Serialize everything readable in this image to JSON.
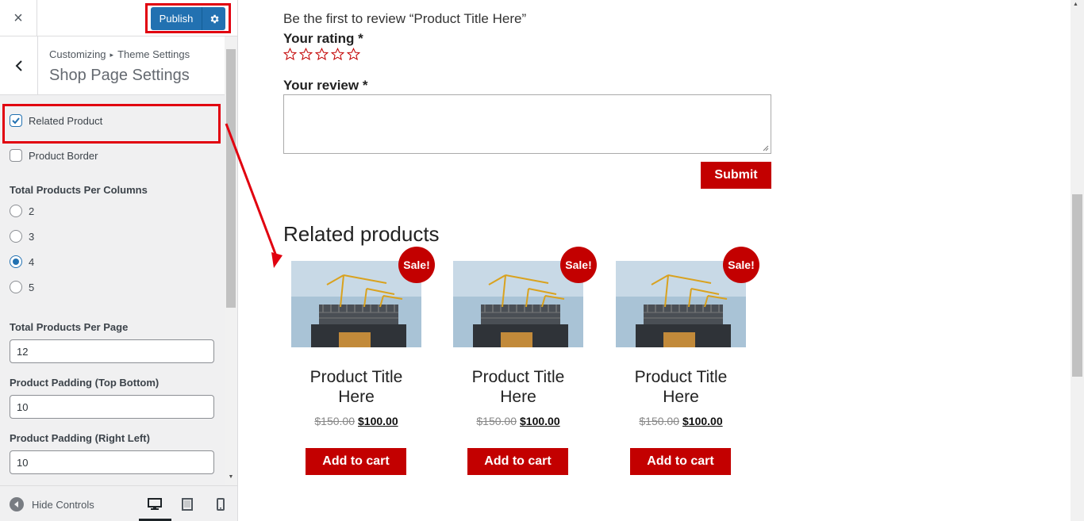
{
  "panel": {
    "close_label": "×",
    "publish_label": "Publish",
    "breadcrumb": {
      "root": "Customizing",
      "separator": "▸",
      "parent": "Theme Settings"
    },
    "section_title": "Shop Page Settings",
    "controls": {
      "related_product": {
        "label": "Related Product",
        "checked": true
      },
      "product_border": {
        "label": "Product Border",
        "checked": false
      },
      "columns": {
        "label": "Total Products Per Columns",
        "options": [
          "2",
          "3",
          "4",
          "5"
        ],
        "selected": "4"
      },
      "per_page": {
        "label": "Total Products Per Page",
        "value": "12"
      },
      "padding_tb": {
        "label": "Product Padding (Top Bottom)",
        "value": "10"
      },
      "padding_rl": {
        "label": "Product Padding (Right Left)",
        "value": "10"
      }
    },
    "footer": {
      "hide_controls_label": "Hide Controls",
      "active_device": "desktop"
    }
  },
  "preview": {
    "review_lead": "Be the first to review “Product Title Here”",
    "rating_label": "Your rating *",
    "star_count": 5,
    "review_label": "Your review *",
    "review_value": "",
    "submit_label": "Submit",
    "related_heading": "Related products",
    "products": [
      {
        "sale_badge": "Sale!",
        "title": "Product Title Here",
        "old_price": "$150.00",
        "new_price": "$100.00",
        "cart_label": "Add to cart"
      },
      {
        "sale_badge": "Sale!",
        "title": "Product Title Here",
        "old_price": "$150.00",
        "new_price": "$100.00",
        "cart_label": "Add to cart"
      },
      {
        "sale_badge": "Sale!",
        "title": "Product Title Here",
        "old_price": "$150.00",
        "new_price": "$100.00",
        "cart_label": "Add to cart"
      }
    ]
  },
  "colors": {
    "publish_blue": "#2271b1",
    "accent_red": "#c30000",
    "annotation_red": "#e1000f",
    "panel_bg": "#f0f0f1"
  },
  "icons": {
    "close": "close-icon",
    "settings": "gear-icon",
    "back": "chevron-left-icon",
    "hide": "arrow-left-circle-icon",
    "desktop": "desktop-icon",
    "tablet": "tablet-icon",
    "mobile": "mobile-icon",
    "star": "star-outline-icon"
  }
}
